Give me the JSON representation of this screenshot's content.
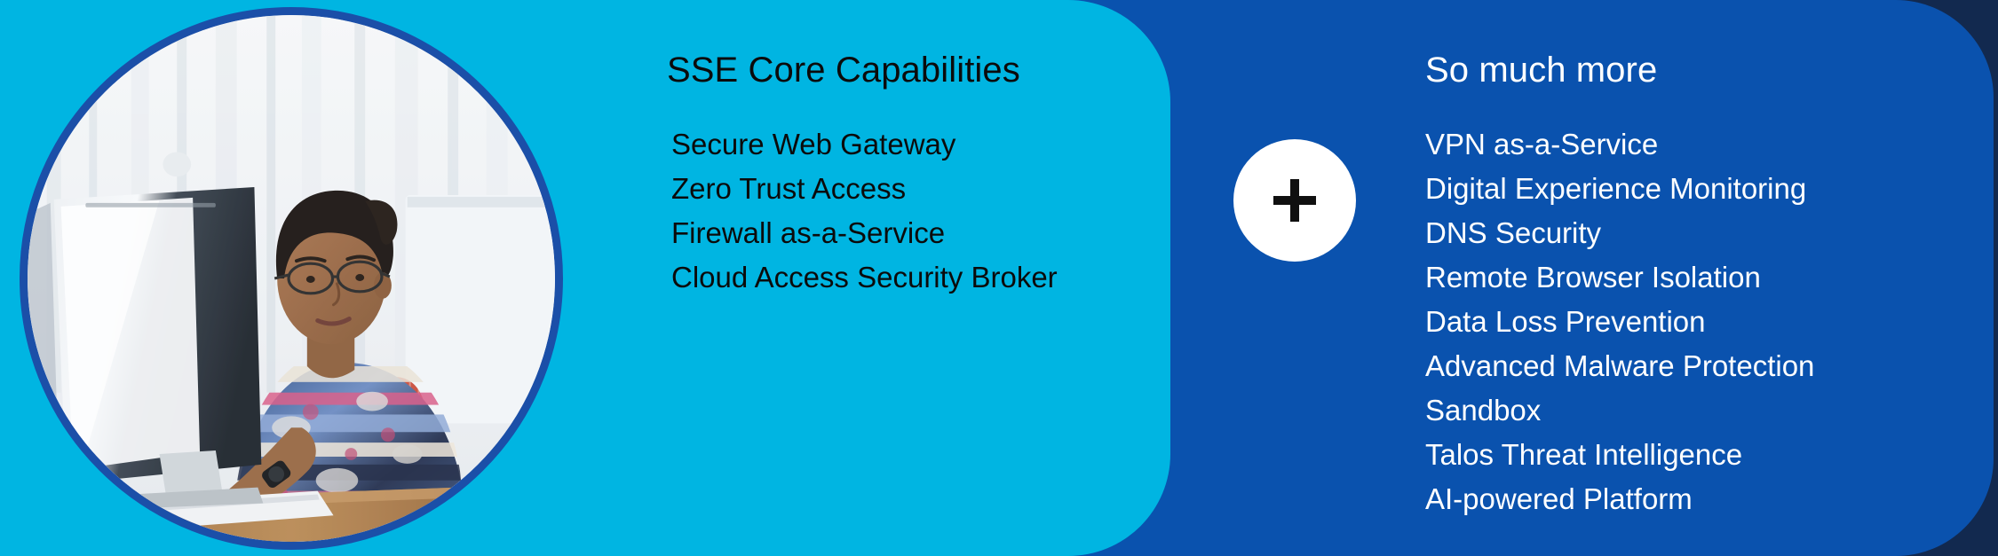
{
  "banner": {
    "background_color": "#12294f",
    "cyan_panel_color": "#00b5e2",
    "blue_panel_color": "#0a52ae",
    "photo_ring_color": "#1b4fa8",
    "plus_badge_color": "#ffffff",
    "plus_glyph_color": "#101010",
    "plus_symbol": "+"
  },
  "photo": {
    "alt": "Woman with glasses working at a desktop computer in a bright office"
  },
  "left_column": {
    "heading": "SSE Core Capabilities",
    "items": [
      "Secure Web Gateway",
      "Zero Trust Access",
      "Firewall as-a-Service",
      "Cloud Access Security Broker"
    ]
  },
  "right_column": {
    "heading": "So much more",
    "items": [
      "VPN as-a-Service",
      "Digital Experience Monitoring",
      "DNS Security",
      "Remote Browser Isolation",
      "Data Loss Prevention",
      "Advanced Malware Protection",
      "Sandbox",
      "Talos Threat Intelligence",
      "AI-powered Platform"
    ]
  }
}
